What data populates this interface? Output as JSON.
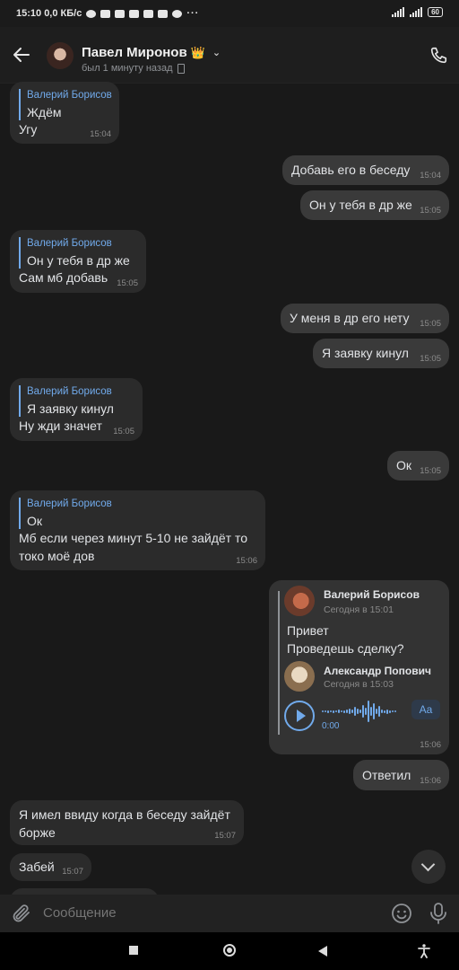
{
  "status_bar": {
    "left_text": "15:10 0,0 КБ/с",
    "battery": "60"
  },
  "header": {
    "name": "Павел Миронов",
    "crown": "👑",
    "last_seen": "был 1 минуту назад"
  },
  "messages": [
    {
      "reply_name": "Валерий Борисов",
      "reply_text": "Ждём",
      "text": "Угу",
      "time": "15:04"
    },
    {
      "text": "Добавь его в беседу",
      "time": "15:04"
    },
    {
      "text": "Он у тебя в др же",
      "time": "15:05"
    },
    {
      "reply_name": "Валерий Борисов",
      "reply_text": "Он у тебя в др же",
      "text": "Сам мб добавь",
      "time": "15:05"
    },
    {
      "text": "У меня в др его нету",
      "time": "15:05"
    },
    {
      "text": "Я заявку кинул",
      "time": "15:05"
    },
    {
      "reply_name": "Валерий Борисов",
      "reply_text": "Я заявку кинул",
      "text": "Ну жди значет",
      "time": "15:05"
    },
    {
      "text": "Ок",
      "time": "15:05"
    },
    {
      "reply_name": "Валерий Борисов",
      "reply_text": "Ок",
      "text": "Мб если через минут 5-10 не зайдёт то\nтоко моё дов",
      "time": "15:06"
    },
    {
      "text": "Ответил",
      "time": "15:06"
    },
    {
      "text": "Я имел ввиду когда в беседу зайдёт\nборже",
      "time": "15:07"
    },
    {
      "text": "Забей",
      "time": "15:07"
    }
  ],
  "forwarded": {
    "author": "Валерий Борисов",
    "date": "Сегодня в 15:01",
    "text": "Привет\nПроведешь сделку?",
    "inner_author": "Александр Попович",
    "inner_date": "Сегодня в 15:03",
    "voice_time": "0:00",
    "transcribe_label": "Aa",
    "time": "15:06"
  },
  "composer": {
    "placeholder": "Сообщение"
  }
}
